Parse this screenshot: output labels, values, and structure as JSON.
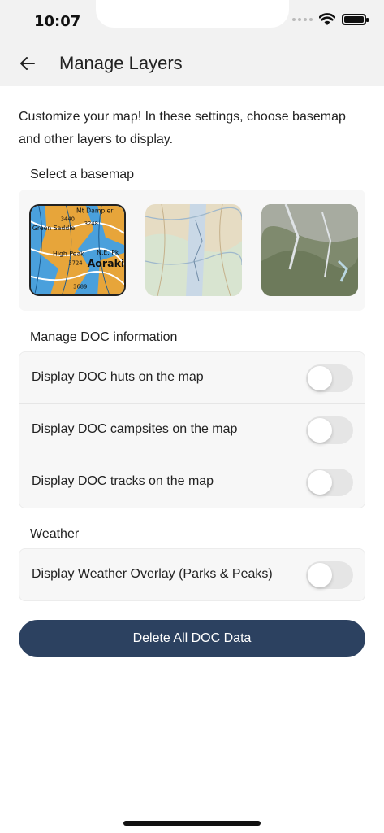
{
  "status_bar": {
    "time": "10:07"
  },
  "header": {
    "title": "Manage Layers"
  },
  "intro": "Customize your map! In these settings, choose basemap and other layers to display.",
  "basemap": {
    "title": "Select a basemap",
    "topo_labels": [
      "Mt Dampier",
      "3440",
      "3248",
      "Green Saddle",
      "High Peak",
      "3724",
      "Aoraki",
      "N.E. Pk",
      "3689"
    ]
  },
  "doc": {
    "title": "Manage DOC information",
    "items": [
      {
        "label": "Display DOC huts on the map"
      },
      {
        "label": "Display DOC campsites on the map"
      },
      {
        "label": "Display DOC tracks on the map"
      }
    ]
  },
  "weather": {
    "title": "Weather",
    "items": [
      {
        "label": "Display Weather Overlay (Parks & Peaks)"
      }
    ]
  },
  "delete_button": "Delete All DOC Data"
}
